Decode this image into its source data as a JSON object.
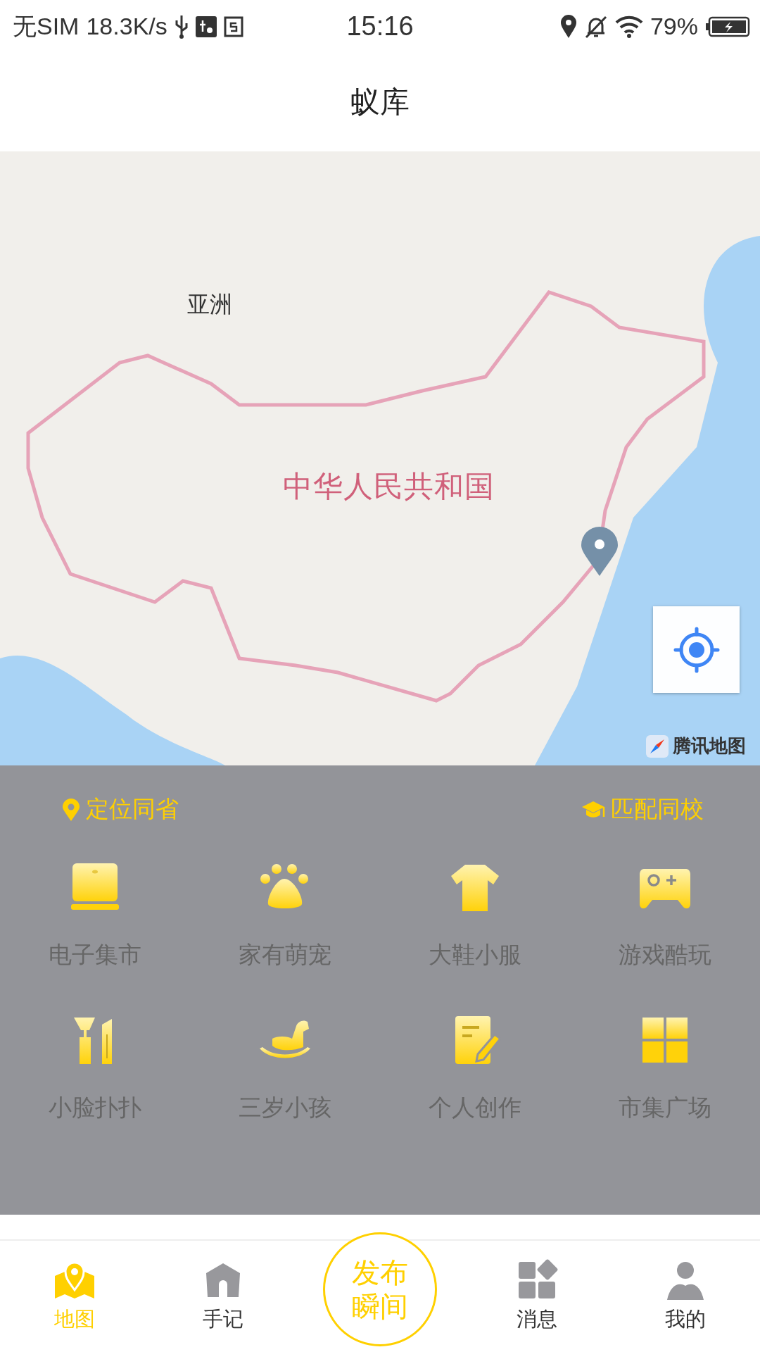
{
  "status_bar": {
    "carrier": "无SIM",
    "speed": "18.3K/s",
    "time": "15:16",
    "battery": "79%"
  },
  "title": "蚁库",
  "map": {
    "labels": [
      {
        "text": "亚洲",
        "kind": "region"
      },
      {
        "text": "中华人民共和国",
        "kind": "country"
      }
    ],
    "attribution": "腾讯地图"
  },
  "filters": [
    {
      "label": "定位同省",
      "kind": "location"
    },
    {
      "label": "匹配同校",
      "kind": "school"
    }
  ],
  "categories": [
    {
      "label": "电子集市",
      "kind": "laptop"
    },
    {
      "label": "家有萌宠",
      "kind": "paw"
    },
    {
      "label": "大鞋小服",
      "kind": "shirt"
    },
    {
      "label": "游戏酷玩",
      "kind": "gamepad"
    },
    {
      "label": "小脸扑扑",
      "kind": "makeup"
    },
    {
      "label": "三岁小孩",
      "kind": "horse"
    },
    {
      "label": "个人创作",
      "kind": "note"
    },
    {
      "label": "市集广场",
      "kind": "grid"
    }
  ],
  "nav": [
    {
      "label": "地图",
      "kind": "map",
      "selected": true
    },
    {
      "label": "手记",
      "kind": "home",
      "selected": false
    },
    {
      "label": "发布瞬间",
      "kind": "publish",
      "selected": false
    },
    {
      "label": "消息",
      "kind": "apps",
      "selected": false
    },
    {
      "label": "我的",
      "kind": "user",
      "selected": false
    }
  ]
}
